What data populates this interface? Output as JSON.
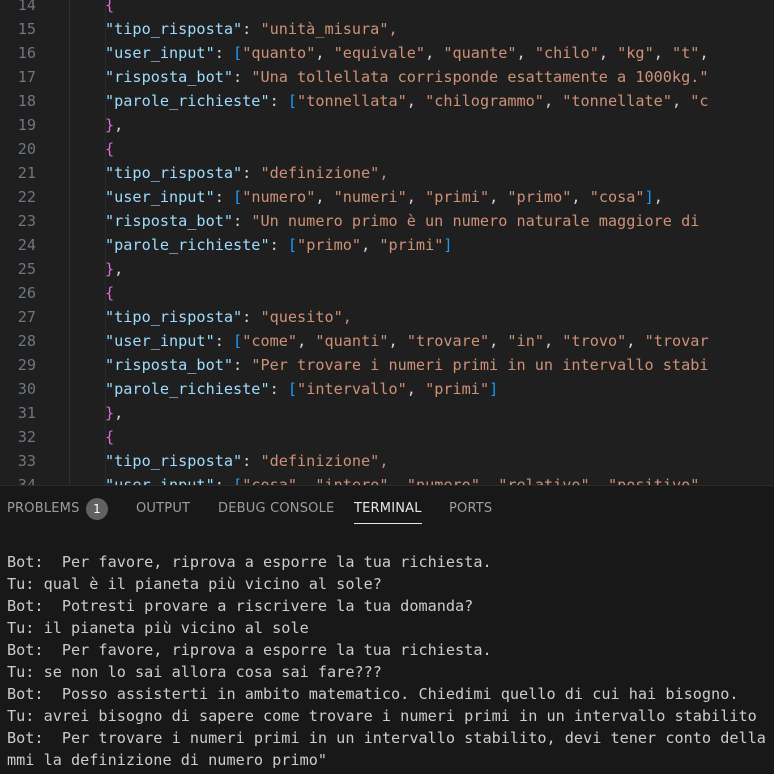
{
  "editor": {
    "lines": [
      {
        "n": "14",
        "indent": 1,
        "kind": "open"
      },
      {
        "n": "15",
        "indent": 2,
        "kind": "kv",
        "key": "\"tipo_risposta\"",
        "value": "\"unità_misura\","
      },
      {
        "n": "16",
        "indent": 2,
        "kind": "kv-arr",
        "key": "\"user_input\"",
        "items": [
          "\"quanto\"",
          "\"equivale\"",
          "\"quante\"",
          "\"chilo\"",
          "\"kg\"",
          "\"t\""
        ],
        "tail": ","
      },
      {
        "n": "17",
        "indent": 2,
        "kind": "kv",
        "key": "\"risposta_bot\"",
        "value": "\"Una tollellata corrisponde esattamente a 1000kg.\""
      },
      {
        "n": "18",
        "indent": 2,
        "kind": "kv-arr",
        "key": "\"parole_richieste\"",
        "items": [
          "\"tonnellata\"",
          "\"chilogrammo\"",
          "\"tonnellate\"",
          "\"c"
        ],
        "tail": ""
      },
      {
        "n": "19",
        "indent": 1,
        "kind": "close"
      },
      {
        "n": "20",
        "indent": 1,
        "kind": "open"
      },
      {
        "n": "21",
        "indent": 2,
        "kind": "kv",
        "key": "\"tipo_risposta\"",
        "value": "\"definizione\","
      },
      {
        "n": "22",
        "indent": 2,
        "kind": "kv-arr",
        "key": "\"user_input\"",
        "items": [
          "\"numero\"",
          "\"numeri\"",
          "\"primi\"",
          "\"primo\"",
          "\"cosa\""
        ],
        "tail": "],"
      },
      {
        "n": "23",
        "indent": 2,
        "kind": "kv",
        "key": "\"risposta_bot\"",
        "value": "\"Un numero primo è un numero naturale maggiore di"
      },
      {
        "n": "24",
        "indent": 2,
        "kind": "kv-arr",
        "key": "\"parole_richieste\"",
        "items": [
          "\"primo\"",
          "\"primi\""
        ],
        "tail": "]"
      },
      {
        "n": "25",
        "indent": 1,
        "kind": "close"
      },
      {
        "n": "26",
        "indent": 1,
        "kind": "open"
      },
      {
        "n": "27",
        "indent": 2,
        "kind": "kv",
        "key": "\"tipo_risposta\"",
        "value": "\"quesito\","
      },
      {
        "n": "28",
        "indent": 2,
        "kind": "kv-arr",
        "key": "\"user_input\"",
        "items": [
          "\"come\"",
          "\"quanti\"",
          "\"trovare\"",
          "\"in\"",
          "\"trovo\"",
          "\"trovar"
        ],
        "tail": ""
      },
      {
        "n": "29",
        "indent": 2,
        "kind": "kv",
        "key": "\"risposta_bot\"",
        "value": "\"Per trovare i numeri primi in un intervallo stabi"
      },
      {
        "n": "30",
        "indent": 2,
        "kind": "kv-arr",
        "key": "\"parole_richieste\"",
        "items": [
          "\"intervallo\"",
          "\"primi\""
        ],
        "tail": "]"
      },
      {
        "n": "31",
        "indent": 1,
        "kind": "close"
      },
      {
        "n": "32",
        "indent": 1,
        "kind": "open"
      },
      {
        "n": "33",
        "indent": 2,
        "kind": "kv",
        "key": "\"tipo_risposta\"",
        "value": "\"definizione\","
      },
      {
        "n": "34",
        "indent": 2,
        "kind": "kv-arr",
        "key": "\"user_input\"",
        "items": [
          "\"cosa\"",
          "\"intero\"",
          "\"numero\"",
          "\"relativo\"",
          "\"positivo\""
        ],
        "tail": ""
      }
    ]
  },
  "panel": {
    "tabs": [
      {
        "label": "PROBLEMS",
        "badge": "1",
        "active": false
      },
      {
        "label": "OUTPUT",
        "active": false
      },
      {
        "label": "DEBUG CONSOLE",
        "active": false
      },
      {
        "label": "TERMINAL",
        "active": true
      },
      {
        "label": "PORTS",
        "active": false
      }
    ]
  },
  "terminal": {
    "lines": [
      "Bot:  Per favore, riprova a esporre la tua richiesta.",
      "Tu: qual è il pianeta più vicino al sole?",
      "Bot:  Potresti provare a riscrivere la tua domanda?",
      "Tu: il pianeta più vicino al sole",
      "Bot:  Per favore, riprova a esporre la tua richiesta.",
      "Tu: se non lo sai allora cosa sai fare???",
      "Bot:  Posso assisterti in ambito matematico. Chiedimi quello di cui hai bisogno.",
      "Tu: avrei bisogno di sapere come trovare i numeri primi in un intervallo stabilito",
      "Bot:  Per trovare i numeri primi in un intervallo stabilito, devi tener conto della de",
      "mmi la definizione di numero primo\""
    ]
  },
  "colors": {
    "key": "#9cdcfe",
    "string": "#ce9178",
    "punct": "#d4d4d4",
    "brace": "#da70d6",
    "bracket": "#179fff",
    "lineNumber": "#6e7681",
    "editorBg": "#1f1f1f",
    "panelBg": "#181818"
  }
}
